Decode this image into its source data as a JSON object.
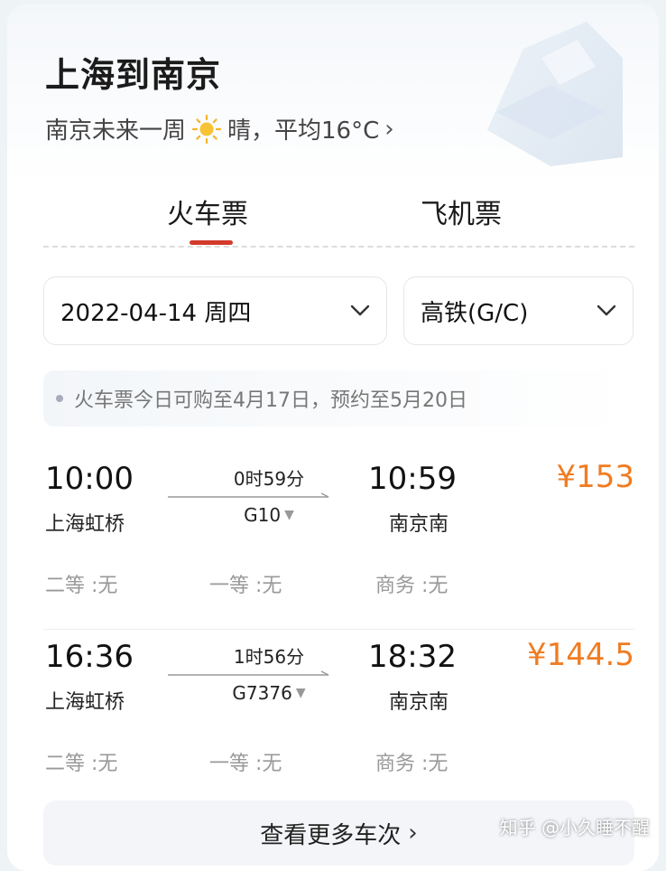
{
  "header": {
    "title": "上海到南京",
    "weather_prefix": "南京未来一周",
    "weather_icon": "sun-icon",
    "weather_text": "晴，平均16°C",
    "weather_chevron": "›"
  },
  "tabs": [
    {
      "label": "火车票",
      "active": true
    },
    {
      "label": "飞机票",
      "active": false
    }
  ],
  "accent": {
    "tab_underline": "#d33a2c",
    "price": "#f07c22"
  },
  "filters": {
    "date": "2022-04-14 周四",
    "train_type": "高铁(G/C)"
  },
  "notice": "火车票今日可购至4月17日，预约至5月20日",
  "trains": [
    {
      "depart_time": "10:00",
      "depart_station": "上海虹桥",
      "duration": "0时59分",
      "train_no": "G10",
      "arrive_time": "10:59",
      "arrive_station": "南京南",
      "price": "¥153",
      "seats": [
        "二等 :无",
        "一等 :无",
        "商务 :无"
      ]
    },
    {
      "depart_time": "16:36",
      "depart_station": "上海虹桥",
      "duration": "1时56分",
      "train_no": "G7376",
      "arrive_time": "18:32",
      "arrive_station": "南京南",
      "price": "¥144.5",
      "seats": [
        "二等 :无",
        "一等 :无",
        "商务 :无"
      ]
    }
  ],
  "more": {
    "label": "查看更多车次",
    "chevron": "›"
  },
  "watermark": "知乎 @小久睡不醒"
}
